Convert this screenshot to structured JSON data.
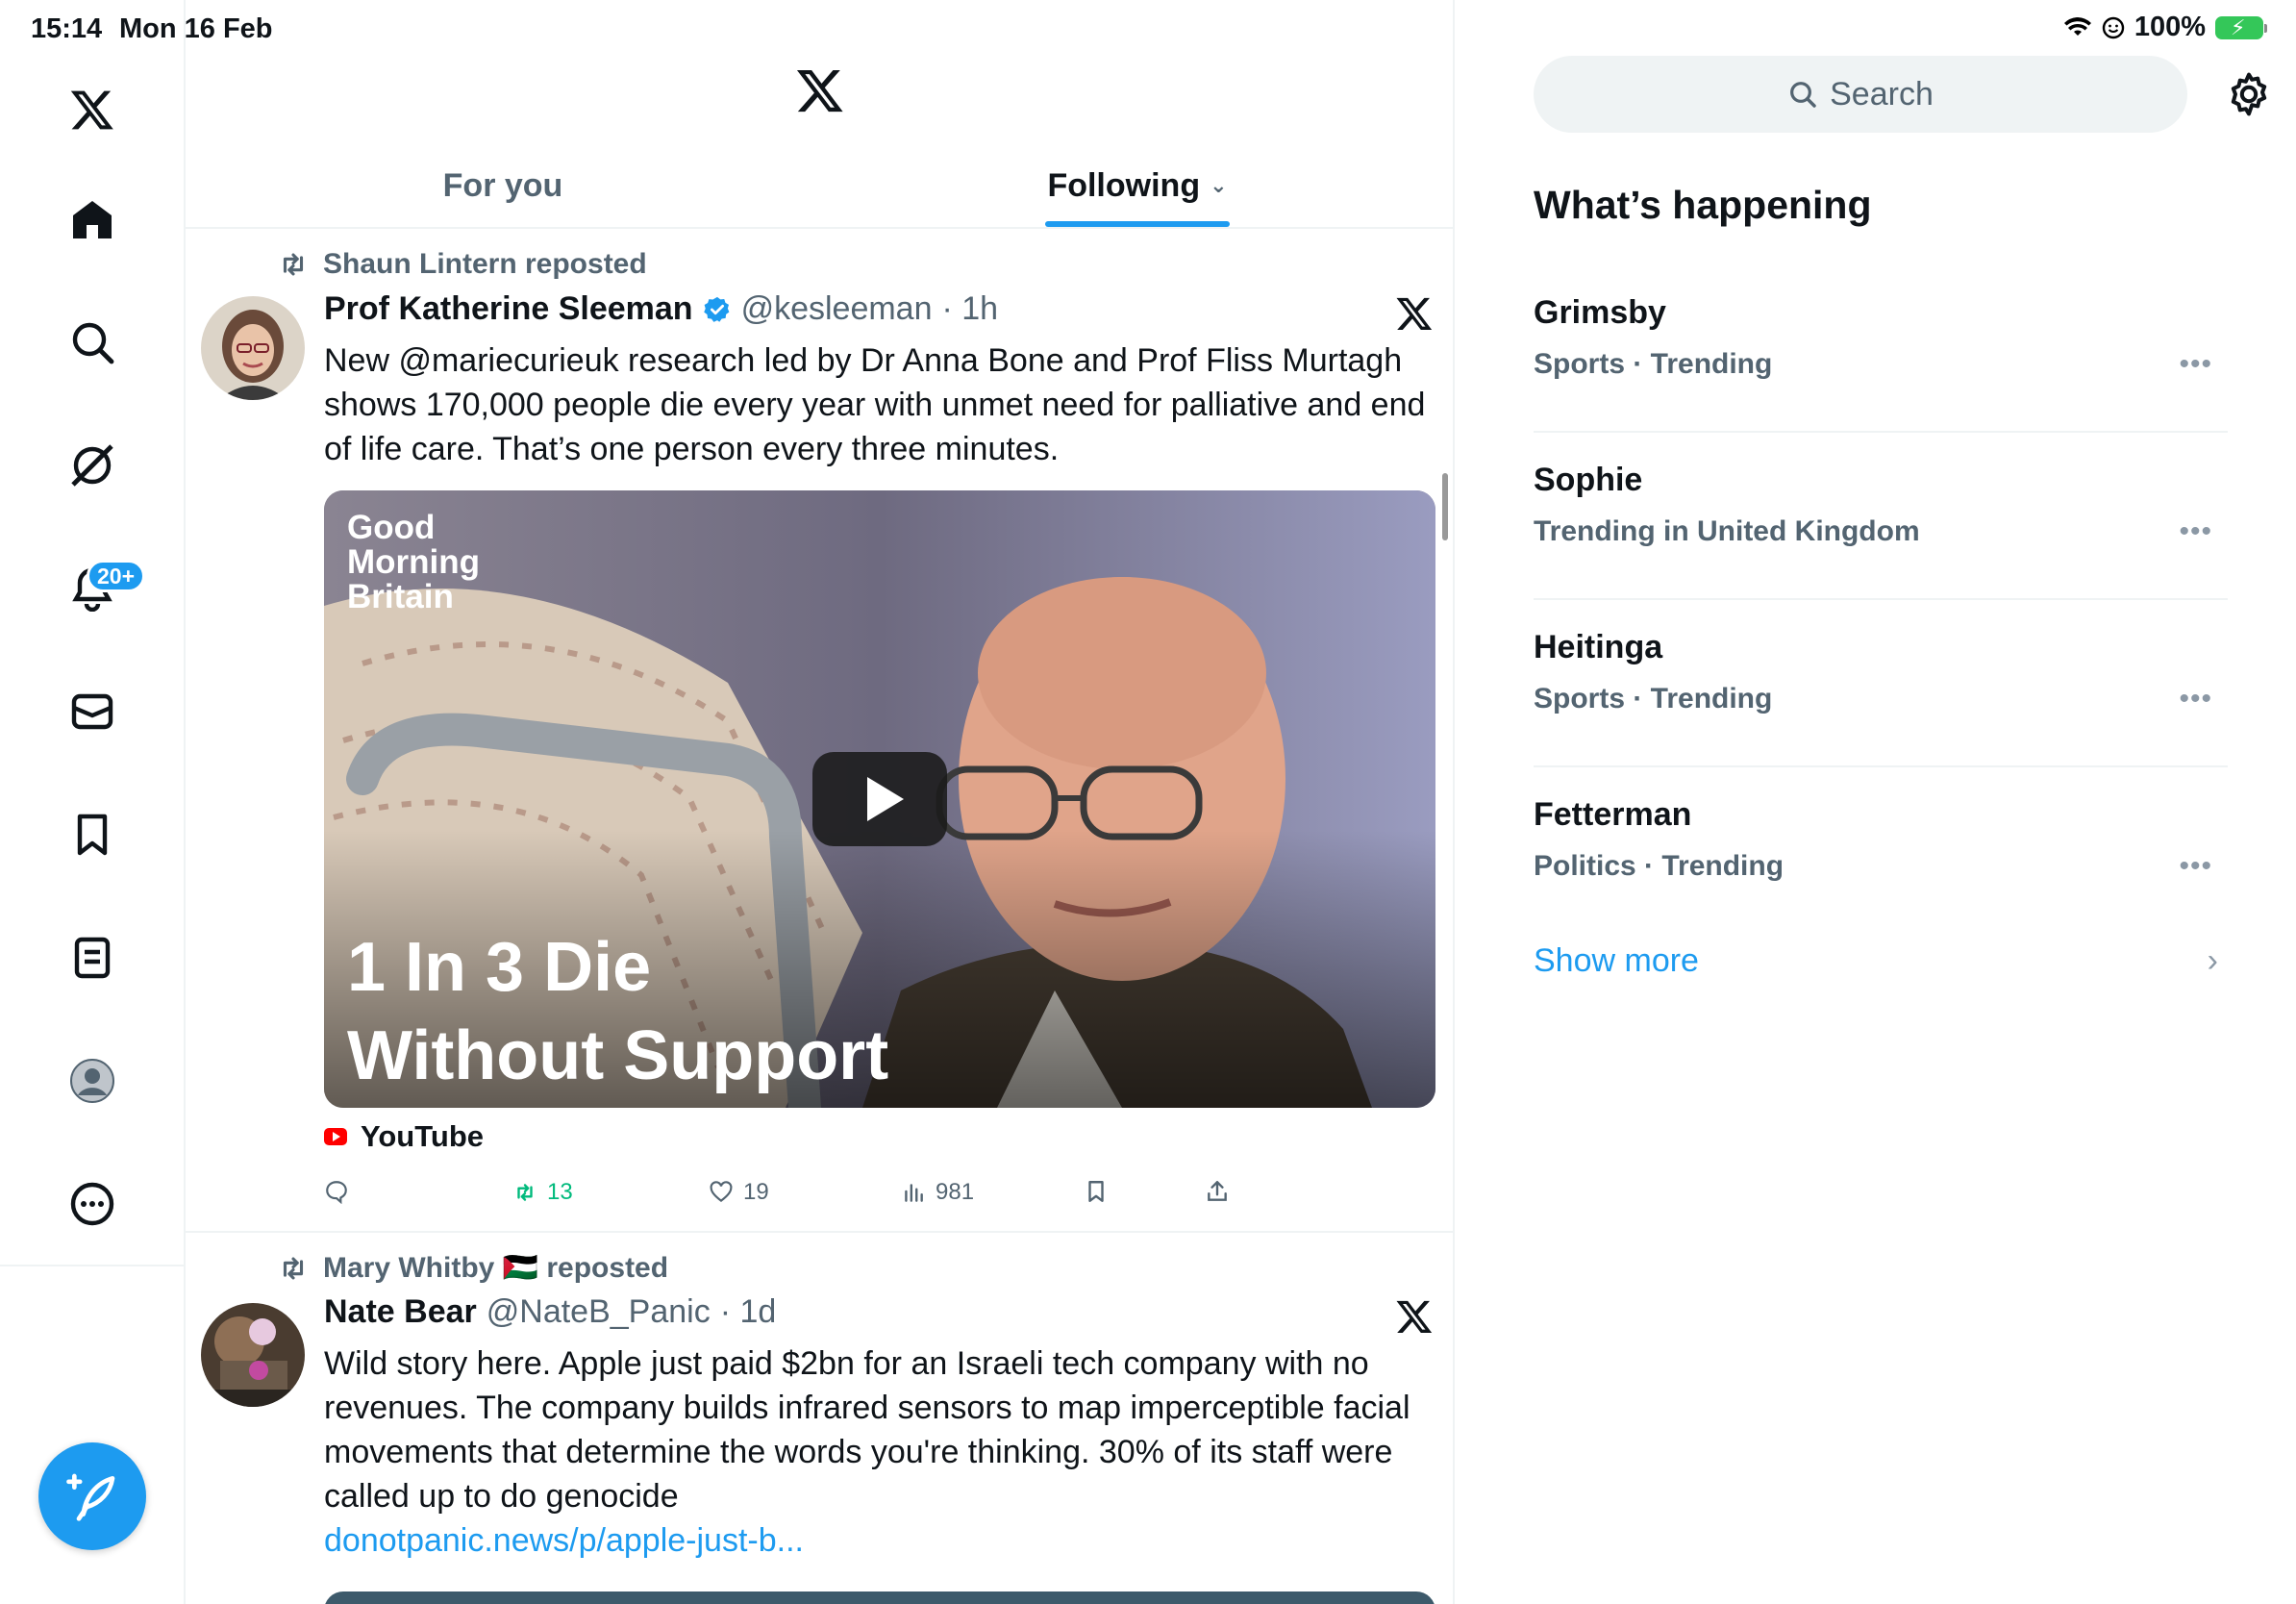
{
  "status_bar": {
    "time": "15:14",
    "date": "Mon 16 Feb",
    "battery": "100%"
  },
  "nav": {
    "notifications_badge": "20+"
  },
  "main": {
    "tabs": [
      {
        "label": "For you"
      },
      {
        "label": "Following"
      }
    ]
  },
  "tweets": [
    {
      "repost_by": "Shaun Lintern reposted",
      "name": "Prof Katherine Sleeman",
      "handle": "@kesleeman",
      "time": "· 1h",
      "text": "New @mariecurieuk research led by Dr Anna Bone and Prof Fliss Murtagh shows 170,000 people die every year with unmet need for palliative and end of life care. That’s one person every three minutes.",
      "media": {
        "logo_line1": "Good",
        "logo_line2": "Morning",
        "logo_line3": "Britain",
        "headline1": "1 In 3 Die",
        "headline2": "Without Support"
      },
      "source": "YouTube",
      "retweets": "13",
      "likes": "19",
      "views": "981"
    },
    {
      "repost_by": "Mary Whitby 🇵🇸 reposted",
      "name": "Nate Bear",
      "handle": "@NateB_Panic",
      "time": "· 1d",
      "text": "Wild story here. Apple just paid $2bn for an Israeli tech company with no revenues. The company builds infrared sensors to map imperceptible facial movements that determine the words you're thinking. 30% of its staff were called up to do genocide",
      "link": "donotpanic.news/p/apple-just-b..."
    }
  ],
  "right": {
    "search_placeholder": "Search",
    "title": "What’s happening",
    "trends": [
      {
        "name": "Grimsby",
        "meta": "Sports · Trending"
      },
      {
        "name": "Sophie",
        "meta": "Trending in United Kingdom"
      },
      {
        "name": "Heitinga",
        "meta": "Sports · Trending"
      },
      {
        "name": "Fetterman",
        "meta": "Politics · Trending"
      }
    ],
    "show_more": "Show more"
  },
  "colors": {
    "accent": "#1d9bf0",
    "retweet_green": "#00ba7c",
    "secondary_text": "#536471"
  }
}
